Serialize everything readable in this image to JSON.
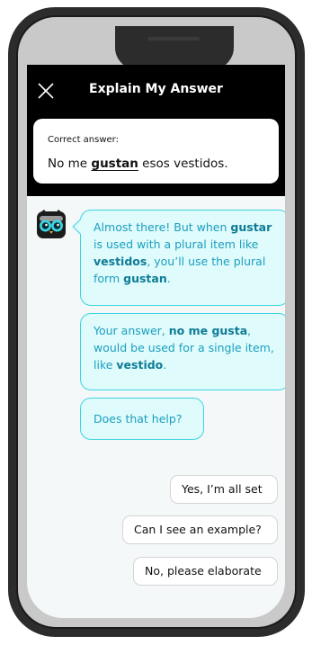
{
  "header": {
    "title": "Explain My Answer",
    "close_icon": "close-icon"
  },
  "correct_answer": {
    "label": "Correct answer:",
    "before": "No me ",
    "highlight": "gustan",
    "after": " esos vestidos."
  },
  "chat": {
    "bubble_1": {
      "t1": "Almost there! But when ",
      "b1": "gustar",
      "t2": " is used with a plural item like ",
      "b2": "vestidos",
      "t3": ", you’ll use the plural form ",
      "b3": "gustan",
      "t4": "."
    },
    "bubble_2": {
      "t1": "Your answer, ",
      "b1": "no me gusta",
      "t2": ", would be used for a single item, like ",
      "b2": "vestido",
      "t3": "."
    },
    "bubble_3": {
      "text": "Does that help?"
    }
  },
  "replies": [
    "Yes, I’m all set",
    "Can I see an example?",
    "No, please elaborate"
  ],
  "colors": {
    "bubble_bg": "#dffbfb",
    "bubble_border": "#3ad5e2",
    "bubble_text": "#1b9ec0",
    "header_bg": "#000000"
  }
}
